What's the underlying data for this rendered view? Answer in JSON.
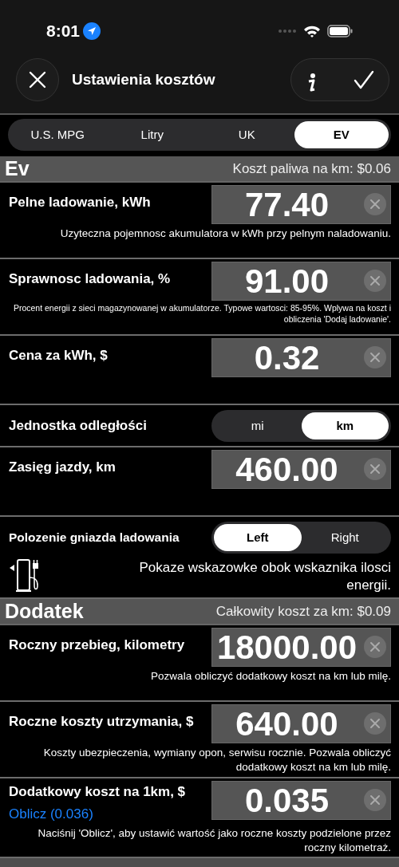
{
  "status_bar": {
    "time": "8:01"
  },
  "header": {
    "title": "Ustawienia kosztów"
  },
  "unit_tabs": [
    {
      "label": "U.S. MPG",
      "selected": false
    },
    {
      "label": "Litry",
      "selected": false
    },
    {
      "label": "UK",
      "selected": false
    },
    {
      "label": "EV",
      "selected": true
    }
  ],
  "sections": [
    {
      "title": "Ev",
      "summary": "Koszt paliwa na km: $0.06",
      "rows": [
        {
          "kind": "field",
          "label": "Pelne ladowanie, kWh",
          "value": "77.40",
          "hint": "Uzyteczna pojemnosc akumulatora w kWh przy pelnym naladowaniu."
        },
        {
          "kind": "field",
          "label": "Sprawnosc ladowania, %",
          "value": "91.00",
          "hint": "Procent energii z sieci magazynowanej w akumulatorze. Typowe wartosci: 85-95%. Wplywa na koszt i obliczenia 'Dodaj ladowanie'.",
          "small_hint": true
        },
        {
          "kind": "field",
          "label": "Cena za kWh, $",
          "value": "0.32"
        },
        {
          "kind": "segmented",
          "label": "Jednostka odległości",
          "options": [
            {
              "label": "mi",
              "selected": false
            },
            {
              "label": "km",
              "selected": true
            }
          ]
        },
        {
          "kind": "field",
          "label": "Zasięg jazdy, km",
          "value": "460.00"
        },
        {
          "kind": "segmented",
          "label": "Polozenie gniazda ladowania",
          "options": [
            {
              "label": "Left",
              "selected": true
            },
            {
              "label": "Right",
              "selected": false
            }
          ],
          "hint": "Pokaze wskazowke obok wskaznika ilosci energii."
        }
      ]
    },
    {
      "title": "Dodatek",
      "summary": "Całkowity koszt za km: $0.09",
      "rows": [
        {
          "kind": "field",
          "label": "Roczny przebieg, kilometry",
          "value": "18000.00",
          "hint": "Pozwala obliczyć dodatkowy koszt na km lub milę."
        },
        {
          "kind": "field",
          "label": "Roczne koszty utrzymania, $",
          "value": "640.00",
          "hint": "Koszty ubezpieczenia, wymiany opon, serwisu rocznie. Pozwala obliczyć dodatkowy koszt na km lub milę."
        },
        {
          "kind": "field",
          "label": "Dodatkowy koszt na 1km, $",
          "value": "0.035",
          "link": "Oblicz (0.036)",
          "hint": "Naciśnij 'Oblicz', aby ustawić wartość jako roczne koszty podzielone przez roczny kilometraż."
        }
      ]
    },
    {
      "kind": "cut"
    }
  ]
}
